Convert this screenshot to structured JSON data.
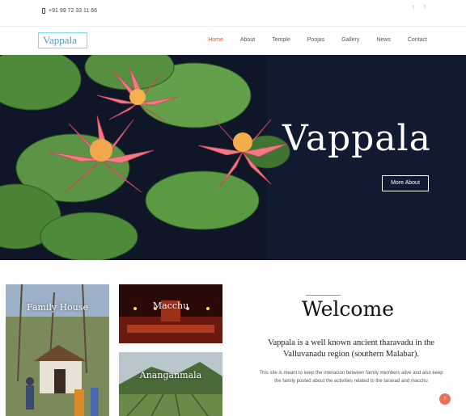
{
  "topbar": {
    "phone_icon": "phone-icon",
    "phone": "+91 99 72 33 11 66",
    "social": [
      {
        "name": "twitter-icon",
        "glyph": "t"
      },
      {
        "name": "facebook-icon",
        "glyph": "f"
      }
    ]
  },
  "nav": {
    "logo": "Vappala",
    "items": [
      "Home",
      "About",
      "Temple",
      "Poojas",
      "Gallery",
      "News",
      "Contact"
    ],
    "active_color": "#d9532b"
  },
  "hero": {
    "title": "Vappala",
    "button": "More About"
  },
  "cards": {
    "family_house": "Family House",
    "macchu": "Macchu",
    "ananganmala": "Ananganmala"
  },
  "welcome": {
    "heading": "Welcome",
    "lead": "Vappala is a well known ancient tharavadu in the Valluvanadu region (southern Malabar).",
    "text": "This site is meant to keep the interacion between family members alive and also keep the family posted about the activities related to the taravad and macchu",
    "fab_icon": "arrow-up-icon",
    "fab_glyph": "↑"
  }
}
